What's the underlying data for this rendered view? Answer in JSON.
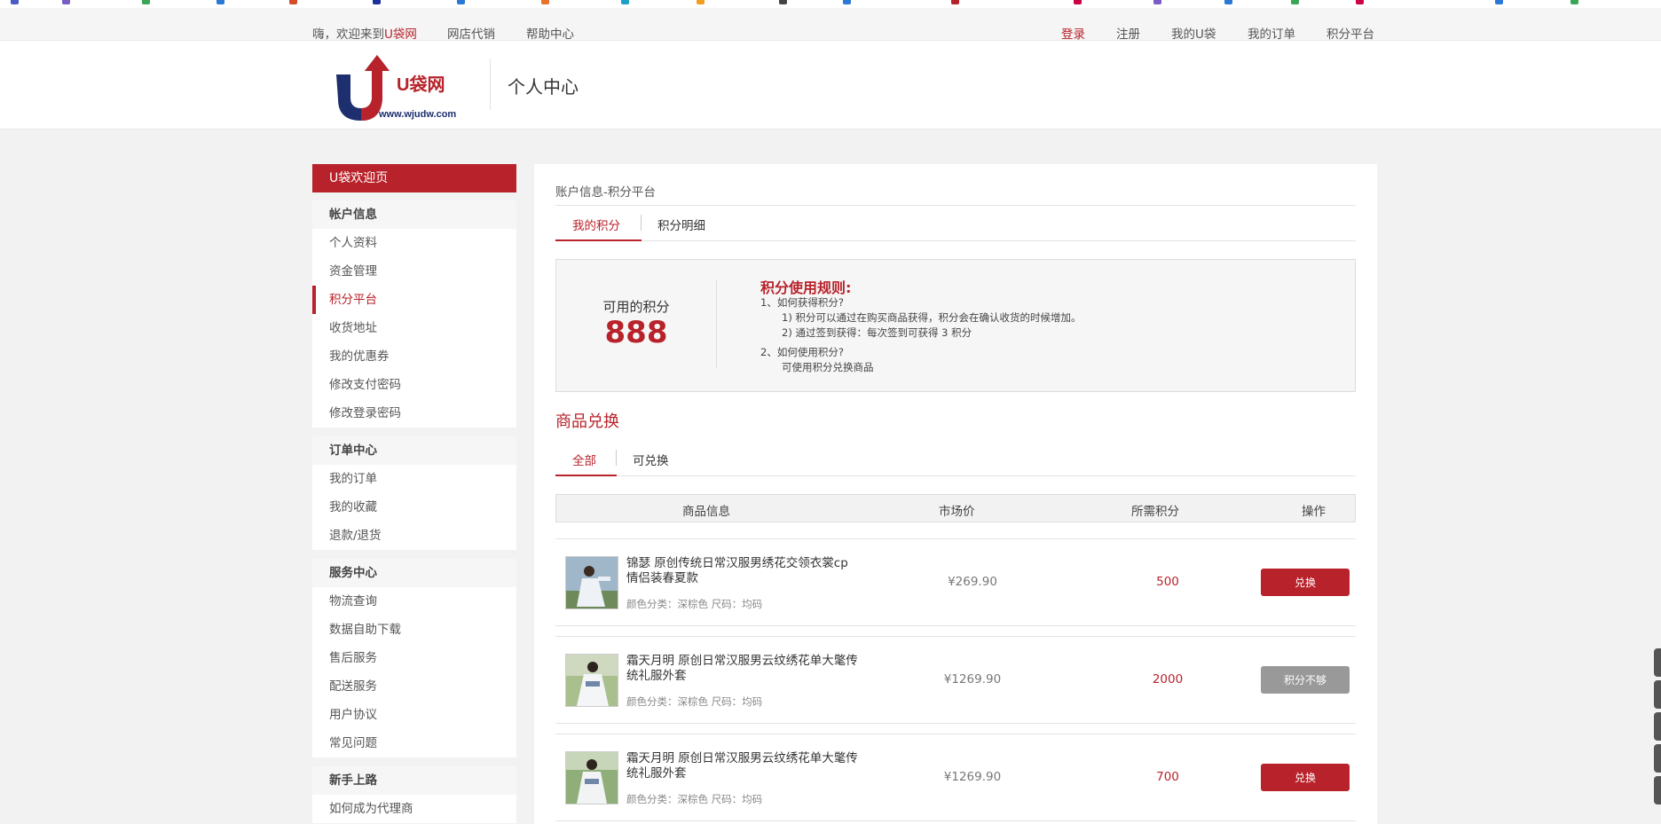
{
  "topbar": {
    "greeting_prefix": "嗨，欢迎来到",
    "greeting_brand": "U袋网",
    "links_left": [
      "网店代销",
      "帮助中心"
    ],
    "login": "登录",
    "links_right": [
      "注册",
      "我的U袋",
      "我的订单",
      "积分平台"
    ]
  },
  "header": {
    "logo_name": "U袋网",
    "logo_url": "www.wjudw.com",
    "title": "个人中心"
  },
  "sidebar": {
    "welcome": "U袋欢迎页",
    "sections": [
      {
        "title": "帐户信息",
        "items": [
          "个人资料",
          "资金管理",
          "积分平台",
          "收货地址",
          "我的优惠券",
          "修改支付密码",
          "修改登录密码"
        ]
      },
      {
        "title": "订单中心",
        "items": [
          "我的订单",
          "我的收藏",
          "退款/退货"
        ]
      },
      {
        "title": "服务中心",
        "items": [
          "物流查询",
          "数据自助下载",
          "售后服务",
          "配送服务",
          "用户协议",
          "常见问题"
        ]
      },
      {
        "title": "新手上路",
        "items": [
          "如何成为代理商"
        ]
      }
    ],
    "active_item": "积分平台"
  },
  "main": {
    "breadcrumb": "账户信息-积分平台",
    "tabs": [
      "我的积分",
      "积分明细"
    ],
    "points": {
      "label": "可用的积分",
      "value": "888",
      "rules_title": "积分使用规则:",
      "rules": [
        "1、如何获得积分?",
        "1) 积分可以通过在购买商品获得，积分会在确认收货的时候增加。",
        "2) 通过签到获得：每次签到可获得 3 积分",
        "2、如何使用积分?",
        "可使用积分兑换商品"
      ]
    },
    "exchange_title": "商品兑换",
    "exchange_tabs": [
      "全部",
      "可兑换"
    ],
    "table_headers": [
      "商品信息",
      "市场价",
      "所需积分",
      "操作"
    ],
    "products": [
      {
        "name": "锦瑟 原创传统日常汉服男绣花交领衣裳cp情侣装春夏款",
        "variant": "颜色分类：深棕色 尺码：均码",
        "price": "¥269.90",
        "points": "500",
        "action": "兑换",
        "enabled": true
      },
      {
        "name": "霜天月明 原创日常汉服男云纹绣花单大氅传统礼服外套",
        "variant": "颜色分类：深棕色 尺码：均码",
        "price": "¥1269.90",
        "points": "2000",
        "action": "积分不够",
        "enabled": false
      },
      {
        "name": "霜天月明 原创日常汉服男云纹绣花单大氅传统礼服外套",
        "variant": "颜色分类：深棕色 尺码：均码",
        "price": "¥1269.90",
        "points": "700",
        "action": "兑换",
        "enabled": true
      }
    ]
  },
  "colors": {
    "accent": "#b8222a",
    "logo_blue": "#1d2f6e",
    "disabled": "#999999"
  }
}
